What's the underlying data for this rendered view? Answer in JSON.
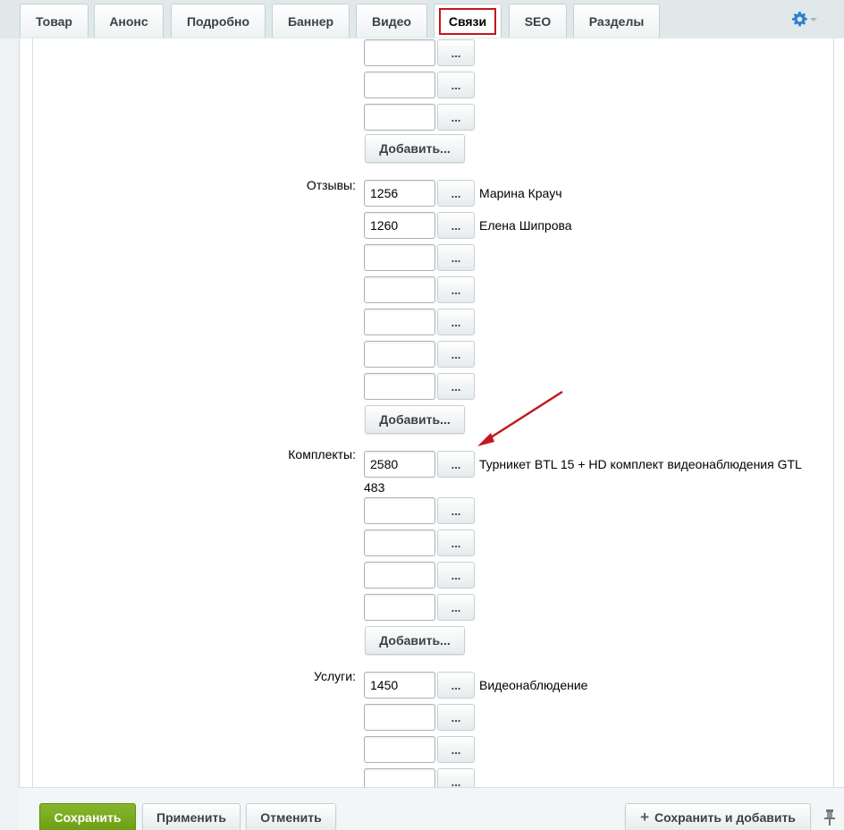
{
  "tabs": [
    {
      "label": "Товар"
    },
    {
      "label": "Анонс"
    },
    {
      "label": "Подробно"
    },
    {
      "label": "Баннер"
    },
    {
      "label": "Видео"
    },
    {
      "label": "Связи",
      "active": true
    },
    {
      "label": "SEO"
    },
    {
      "label": "Разделы"
    }
  ],
  "settings_icon": "gear-icon",
  "links_top": {
    "rows": [
      "",
      "",
      ""
    ],
    "add_label": "Добавить..."
  },
  "reviews": {
    "label": "Отзывы:",
    "rows": [
      {
        "value": "1256",
        "name": "Марина Крауч"
      },
      {
        "value": "1260",
        "name": "Елена Шипрова"
      },
      {
        "value": "",
        "name": ""
      },
      {
        "value": "",
        "name": ""
      },
      {
        "value": "",
        "name": ""
      },
      {
        "value": "",
        "name": ""
      },
      {
        "value": "",
        "name": ""
      }
    ],
    "add_label": "Добавить..."
  },
  "kits": {
    "label": "Комплекты:",
    "rows": [
      {
        "value": "2580",
        "name": "Турникет BTL 15 + HD комплект видеонаблюдения GTL",
        "name_wrap": "483"
      },
      {
        "value": "",
        "name": ""
      },
      {
        "value": "",
        "name": ""
      },
      {
        "value": "",
        "name": ""
      },
      {
        "value": "",
        "name": ""
      }
    ],
    "add_label": "Добавить..."
  },
  "services": {
    "label": "Услуги:",
    "rows": [
      {
        "value": "1450",
        "name": "Видеонаблюдение"
      },
      {
        "value": "",
        "name": ""
      },
      {
        "value": "",
        "name": ""
      },
      {
        "value": "",
        "name": ""
      }
    ]
  },
  "chooser_label": "...",
  "annotation": {
    "color": "#c3171d"
  },
  "footer": {
    "save": "Сохранить",
    "apply": "Применить",
    "cancel": "Отменить",
    "save_add": "Сохранить и добавить",
    "pin_icon": "pin-icon"
  },
  "colors": {
    "accent_green": "#78aa1c",
    "active_tab_outline": "#c3171d",
    "gear_blue": "#2f7fd0"
  }
}
